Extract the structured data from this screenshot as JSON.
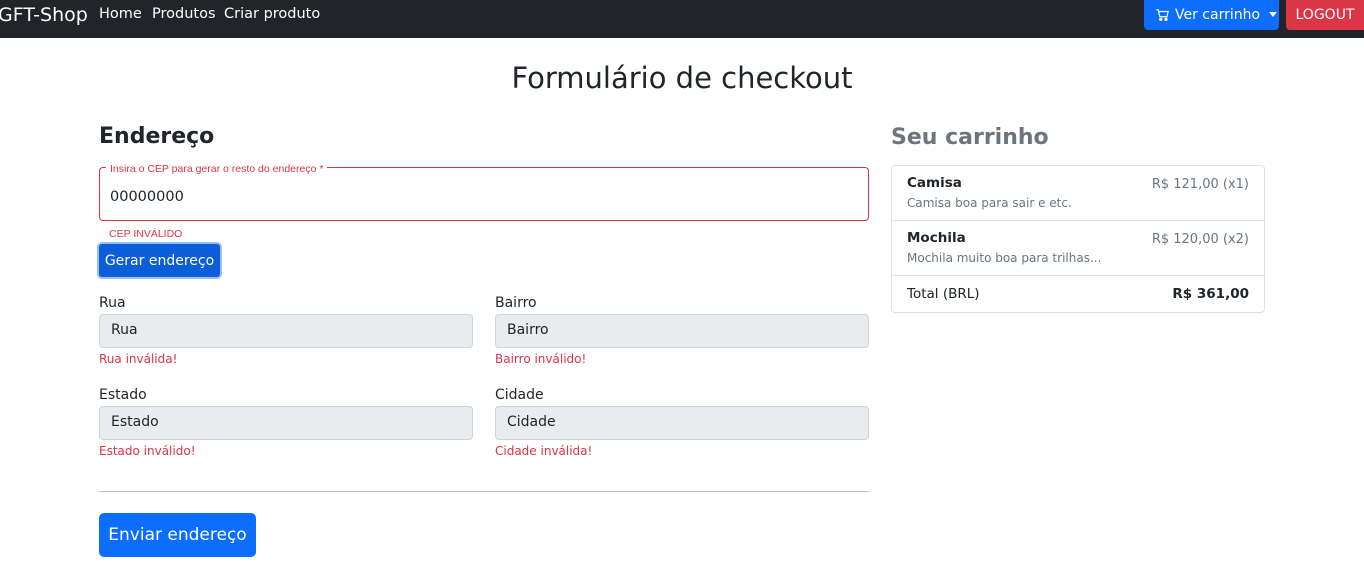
{
  "navbar": {
    "brand": "GFT-Shop",
    "links": [
      "Home",
      "Produtos",
      "Criar produto"
    ],
    "cart_button": "Ver carrinho",
    "logout_button": "LOGOUT"
  },
  "page": {
    "title": "Formulário de checkout"
  },
  "address": {
    "section_title": "Endereço",
    "cep_label": "Insira o CEP para gerar o resto do endereço *",
    "cep_value": "00000000",
    "cep_error": "CEP INVÁLIDO",
    "generate_button": "Gerar endereço",
    "fields": {
      "rua": {
        "label": "Rua",
        "placeholder": "Rua",
        "error": "Rua inválida!"
      },
      "bairro": {
        "label": "Bairro",
        "placeholder": "Bairro",
        "error": "Bairro inválido!"
      },
      "estado": {
        "label": "Estado",
        "placeholder": "Estado",
        "error": "Estado inválido!"
      },
      "cidade": {
        "label": "Cidade",
        "placeholder": "Cidade",
        "error": "Cidade inválida!"
      }
    },
    "submit_button": "Enviar endereço"
  },
  "cart": {
    "title": "Seu carrinho",
    "items": [
      {
        "name": "Camisa",
        "description": "Camisa boa para sair e etc.",
        "price": "R$ 121,00 (x1)"
      },
      {
        "name": "Mochila",
        "description": "Mochila muito boa para trilhas...",
        "price": "R$ 120,00 (x2)"
      }
    ],
    "total_label": "Total (BRL)",
    "total_value": "R$ 361,00"
  },
  "colors": {
    "navbar_bg": "#212529",
    "primary": "#0d6efd",
    "danger": "#dc3545",
    "muted": "#6c757d",
    "input_disabled_bg": "#e9ecef"
  },
  "icons": {
    "cart": "cart-icon",
    "caret": "caret-down-icon"
  }
}
